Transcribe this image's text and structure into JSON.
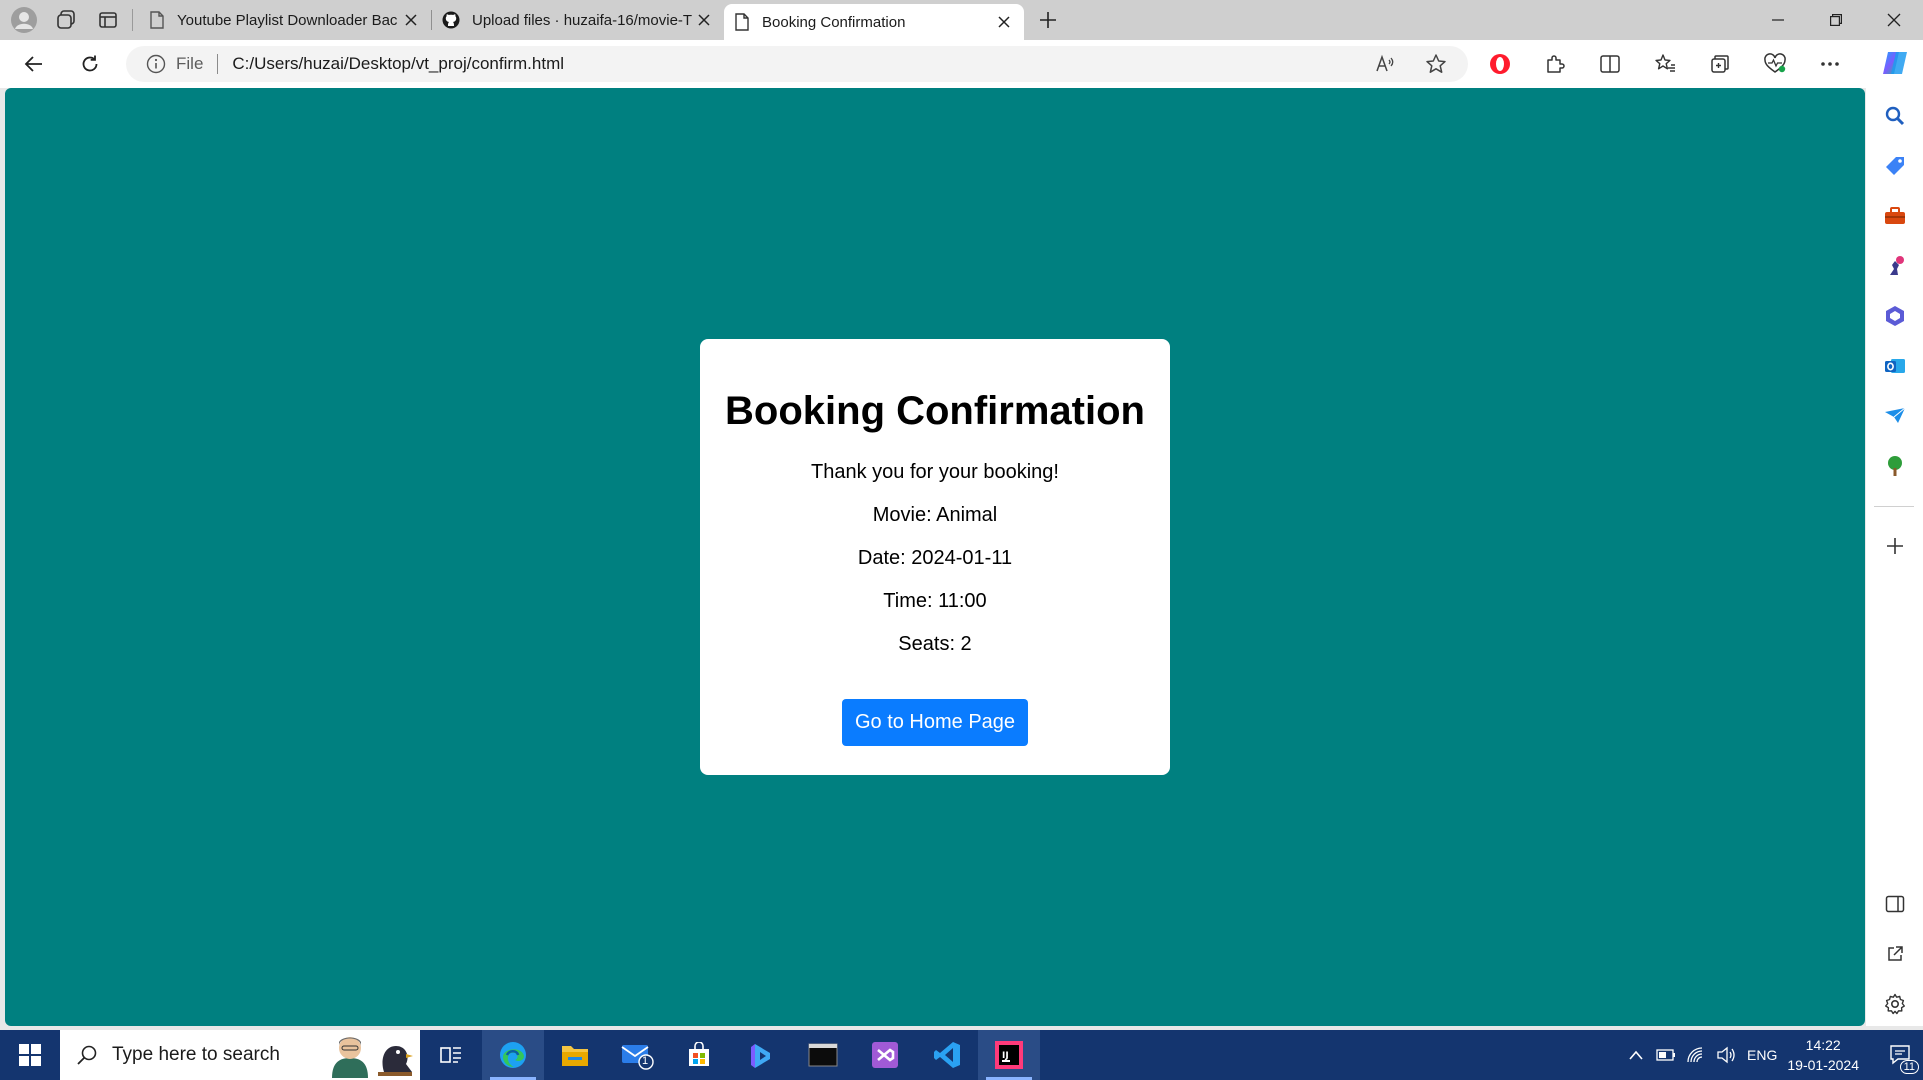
{
  "browser": {
    "tabs": [
      {
        "title": "Youtube Playlist Downloader Bac",
        "icon": "page-icon",
        "active": false
      },
      {
        "title": "Upload files · huzaifa-16/movie-T",
        "icon": "github-icon",
        "active": false
      },
      {
        "title": "Booking Confirmation",
        "icon": "page-icon",
        "active": true
      }
    ],
    "address": {
      "scheme_label": "File",
      "url": "C:/Users/huzai/Desktop/vt_proj/confirm.html"
    }
  },
  "page": {
    "background": "#008080",
    "heading": "Booking Confirmation",
    "thanks": "Thank you for your booking!",
    "movie_line": "Movie: Animal",
    "date_line": "Date: 2024-01-11",
    "time_line": "Time: 11:00",
    "seats_line": "Seats: 2",
    "home_button": "Go to Home Page",
    "button_color": "#0a7cff"
  },
  "sidebar": {
    "icons": [
      "search-icon",
      "shopping-tag-icon",
      "tools-icon",
      "games-icon",
      "microsoft365-icon",
      "outlook-icon",
      "drop-icon",
      "tree-icon",
      "add-icon",
      "hide-sidebar-icon",
      "external-link-icon",
      "settings-icon"
    ]
  },
  "taskbar": {
    "search_placeholder": "Type here to search",
    "mail_badge": "1",
    "apps": [
      "task-view-icon",
      "edge-icon",
      "file-explorer-icon",
      "mail-icon",
      "store-icon",
      "copilot-icon",
      "terminal-icon",
      "visual-studio-icon",
      "vscode-icon",
      "intellij-icon"
    ],
    "language": "ENG",
    "time": "14:22",
    "date": "19-01-2024",
    "notification_count": "11"
  }
}
